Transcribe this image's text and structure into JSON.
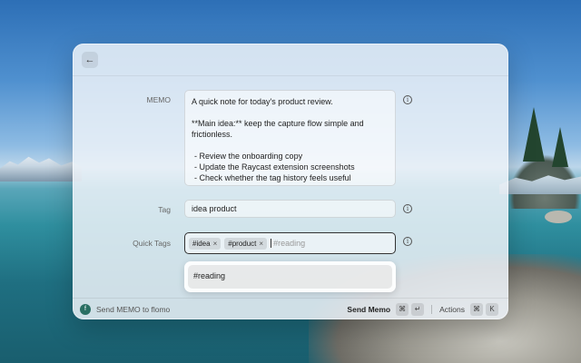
{
  "memo": {
    "label": "MEMO",
    "line1": "A quick note for today's product review.",
    "line2": "**Main idea:** keep the capture flow simple and frictionless.",
    "bullets": [
      "- Review the onboarding copy",
      "- Update the Raycast extension screenshots",
      "- Check whether the tag history feels useful"
    ]
  },
  "tag": {
    "label": "Tag",
    "value": "idea product"
  },
  "quick_tags": {
    "label": "Quick Tags",
    "chips": [
      "#idea",
      "#product"
    ],
    "input_value": "#reading"
  },
  "dropdown": {
    "items": [
      "#reading"
    ]
  },
  "bottom": {
    "title": "Send MEMO to flomo",
    "primary_action": "Send Memo",
    "primary_keys": [
      "⌘",
      "↵"
    ],
    "actions_label": "Actions",
    "actions_keys": [
      "⌘",
      "K"
    ]
  },
  "colors": {
    "accent": "#2a6f63"
  }
}
